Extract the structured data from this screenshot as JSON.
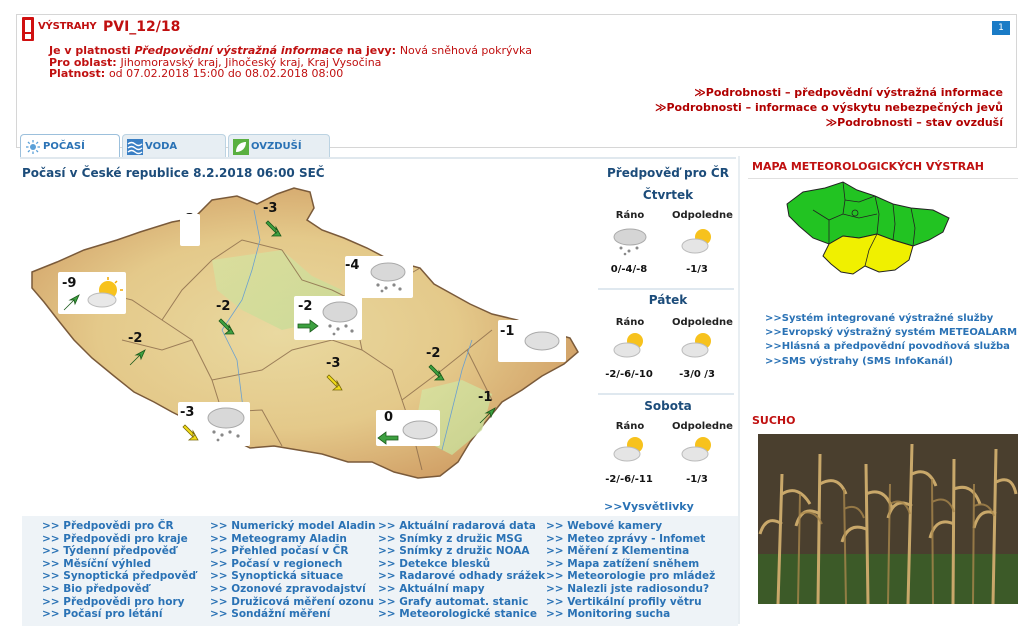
{
  "warning": {
    "logo_text": "VÝSTRAHY",
    "code": "PVI_12/18",
    "page_num": "1",
    "line1_prefix": "Je v platnosti ",
    "line1_italic": "Předpovědní výstražná informace",
    "line1_mid": " na jevy: ",
    "line1_value": "Nová sněhová pokrývka",
    "line2_label": "Pro oblast: ",
    "line2_value": "Jihomoravský kraj, Jihočeský kraj, Kraj Vysočina",
    "line3_label": "Platnost: ",
    "line3_value": "od 07.02.2018 15:00 do 08.02.2018 08:00",
    "links": [
      "≫Podrobnosti – předpovědní výstražná informace",
      "≫Podrobnosti – informace o výskytu nebezpečných jevů",
      "≫Podrobnosti – stav ovzduší"
    ]
  },
  "tabs": [
    {
      "label": "POČASÍ",
      "icon": "sun-icon"
    },
    {
      "label": "VODA",
      "icon": "water-icon"
    },
    {
      "label": "OVZDUŠÍ",
      "icon": "leaf-icon"
    }
  ],
  "forecast": {
    "title": "Počasí v České republice 8.2.2018 06:00 SEČ",
    "map_points": [
      {
        "temp": "-3",
        "weather": "none",
        "wind": "none"
      },
      {
        "temp": "-3",
        "weather": "none",
        "wind": "green-se"
      },
      {
        "temp": "-9",
        "weather": "partly-cloudy",
        "wind": "green-ne"
      },
      {
        "temp": "-4",
        "weather": "snow",
        "wind": "none"
      },
      {
        "temp": "-2",
        "weather": "none",
        "wind": "green-se"
      },
      {
        "temp": "-2",
        "weather": "snow",
        "wind": "green-e"
      },
      {
        "temp": "-2",
        "weather": "none",
        "wind": "green-ne"
      },
      {
        "temp": "-1",
        "weather": "cloudy",
        "wind": "none"
      },
      {
        "temp": "-3",
        "weather": "none",
        "wind": "yellow-se"
      },
      {
        "temp": "-2",
        "weather": "none",
        "wind": "green-se"
      },
      {
        "temp": "-3",
        "weather": "snow",
        "wind": "yellow-se"
      },
      {
        "temp": "0",
        "weather": "cloudy",
        "wind": "green-w"
      },
      {
        "temp": "-1",
        "weather": "none",
        "wind": "green-ne"
      }
    ],
    "explain_link": ">>Vysvětlivky"
  },
  "cr_forecast": {
    "title": "Předpověď pro ČR",
    "days": [
      {
        "name": "Čtvrtek",
        "morning_label": "Ráno",
        "afternoon_label": "Odpoledne",
        "morning": "0/-4/-8",
        "afternoon": "-1/3",
        "morning_icon": "snow-icon",
        "afternoon_icon": "partly-cloudy-icon"
      },
      {
        "name": "Pátek",
        "morning_label": "Ráno",
        "afternoon_label": "Odpoledne",
        "morning": "-2/-6/-10",
        "afternoon": "-3/0 /3",
        "morning_icon": "partly-cloudy-icon",
        "afternoon_icon": "partly-cloudy-icon"
      },
      {
        "name": "Sobota",
        "morning_label": "Ráno",
        "afternoon_label": "Odpoledne",
        "morning": "-2/-6/-11",
        "afternoon": "-1/3",
        "morning_icon": "partly-cloudy-icon",
        "afternoon_icon": "partly-cloudy-icon"
      }
    ]
  },
  "links": {
    "col1": [
      ">> Předpovědi pro ČR",
      ">> Předpovědi pro kraje",
      ">> Týdenní předpověď",
      ">> Měsíční výhled",
      ">> Synoptická předpověď",
      ">> Bio předpověď",
      ">> Předpovědi pro hory",
      ">> Počasí pro létání"
    ],
    "col2": [
      ">> Numerický model Aladin",
      ">> Meteogramy Aladin",
      ">> Přehled počasí v ČR",
      ">> Počasí v regionech",
      ">> Synoptická situace",
      ">> Ozonové zpravodajství",
      ">> Družicová měření ozonu",
      ">> Sondážní měření"
    ],
    "col3": [
      ">> Aktuální radarová data",
      ">> Snímky z družic MSG",
      ">> Snímky z družic NOAA",
      ">> Detekce blesků",
      ">> Radarové odhady srážek",
      ">> Aktuální mapy",
      ">> Grafy automat. stanic",
      ">> Meteorologické stanice"
    ],
    "col4": [
      ">> Webové kamery",
      ">> Meteo zprávy - Infomet",
      ">> Měření z Klementina",
      ">> Mapa zatížení sněhem",
      ">> Meteorologie pro mládež",
      ">> Nalezli jste radiosondu?",
      ">> Vertikální profily větru",
      ">> Monitoring sucha"
    ]
  },
  "sidebar": {
    "map_title": "MAPA METEOROLOGICKÝCH VÝSTRAH",
    "map_links": [
      ">>Systém integrované výstražné služby",
      ">>Evropský výstražný systém METEOALARM",
      ">>Hlásná a předpovědní povodňová služba",
      ">>SMS výstrahy (SMS InfoKanál)"
    ],
    "drought_title": "SUCHO"
  },
  "colors": {
    "accent_red": "#c01010",
    "link_blue": "#2a72b5",
    "warning_green": "#22c322",
    "warning_yellow": "#f0f000"
  }
}
